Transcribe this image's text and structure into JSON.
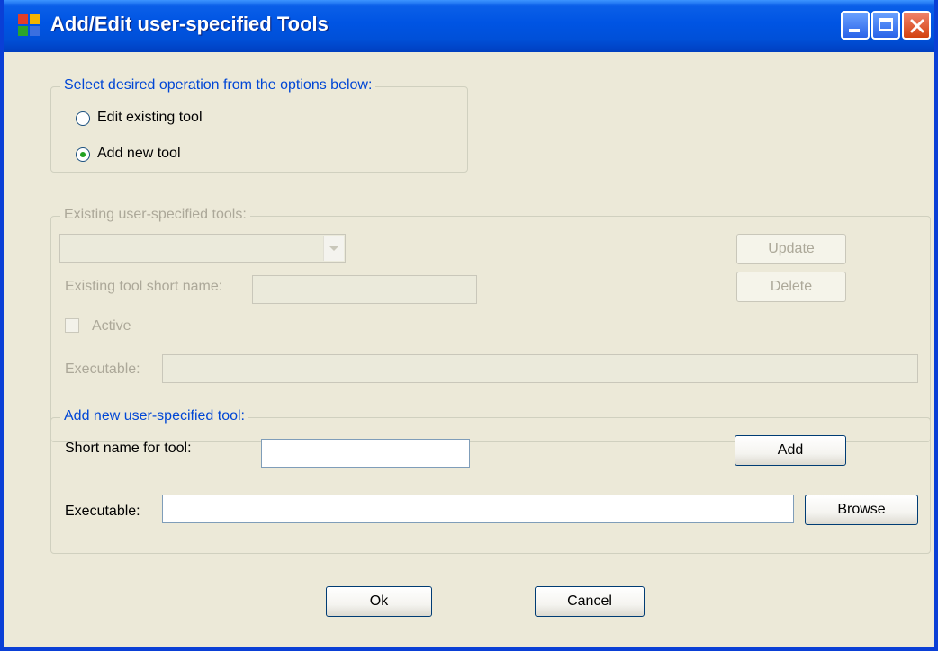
{
  "window": {
    "title": "Add/Edit user-specified Tools"
  },
  "operation": {
    "group_title": "Select desired operation from the options below:",
    "edit_label": "Edit existing tool",
    "add_label": "Add new tool",
    "selected": "add"
  },
  "existing": {
    "group_title": "Existing user-specified tools:",
    "tool_combo_value": "",
    "update_label": "Update",
    "delete_label": "Delete",
    "short_name_label": "Existing tool short name:",
    "short_name_value": "",
    "active_label": "Active",
    "active_checked": false,
    "executable_label": "Executable:",
    "executable_value": ""
  },
  "add_new": {
    "group_title": "Add new user-specified tool:",
    "short_name_label": "Short name for tool:",
    "short_name_value": "",
    "add_label": "Add",
    "executable_label": "Executable:",
    "executable_value": "",
    "browse_label": "Browse"
  },
  "footer": {
    "ok_label": "Ok",
    "cancel_label": "Cancel"
  },
  "colors": {
    "titlebar": "#0054e3",
    "dialog_bg": "#ece9d8",
    "group_title": "#0046d5",
    "disabled_text": "#aca899"
  }
}
